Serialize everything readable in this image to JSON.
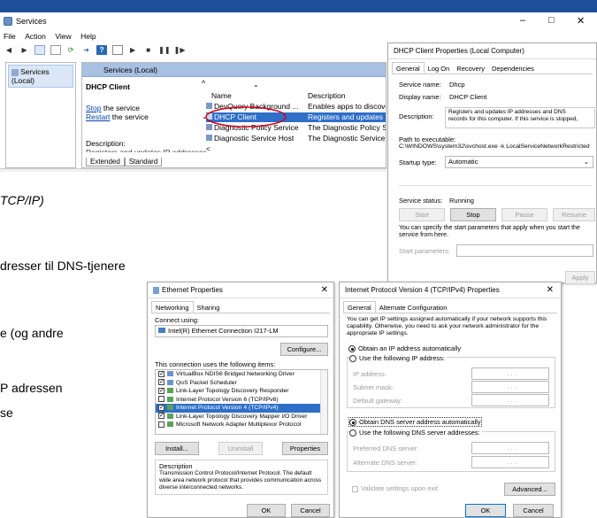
{
  "services": {
    "title": "Services",
    "menu": [
      "File",
      "Action",
      "View",
      "Help"
    ],
    "tree_item": "Services (Local)",
    "panel_header": "Services (Local)",
    "selected_service": "DHCP Client",
    "stop_link": "Stop",
    "stop_suffix": " the service",
    "restart_link": "Restart",
    "restart_suffix": " the service",
    "description_label": "Description:",
    "description_cut": "Registers and updates IP addresses",
    "col_name": "Name",
    "col_description": "Description",
    "rows": [
      {
        "name": "DevQuery Background ...",
        "desc": "Enables apps to discover"
      },
      {
        "name": "DHCP Client",
        "desc": "Registers and updates IP"
      },
      {
        "name": "Diagnostic Policy Service",
        "desc": "The Diagnostic Policy Se"
      },
      {
        "name": "Diagnostic Service Host",
        "desc": "The Diagnostic Service H"
      }
    ],
    "tab_extended": "Extended",
    "tab_standard": "Standard",
    "win_min": "–",
    "win_max": "□",
    "win_close": "✕"
  },
  "dhcp": {
    "title": "DHCP Client Properties (Local Computer)",
    "tabs": [
      "General",
      "Log On",
      "Recovery",
      "Dependencies"
    ],
    "service_name_label": "Service name:",
    "service_name": "Dhcp",
    "display_name_label": "Display name:",
    "display_name": "DHCP Client",
    "description_label": "Description:",
    "description": "Registers and updates IP addresses and DNS records for this computer. If this service is stopped,",
    "path_label": "Path to executable:",
    "path": "C:\\WINDOWS\\system32\\svchost.exe -k LocalServiceNetworkRestricted",
    "startup_label": "Startup type:",
    "startup_value": "Automatic",
    "status_label": "Service status:",
    "status_value": "Running",
    "btn_start": "Start",
    "btn_stop": "Stop",
    "btn_pause": "Pause",
    "btn_resume": "Resume",
    "hint": "You can specify the start parameters that apply when you start the service from here.",
    "start_params_label": "Start parameters:",
    "btn_apply": "Apply"
  },
  "doc_fragments": [
    "TCP/IP)",
    "dresser til DNS-tjenere",
    "e (og andre",
    "P adressen",
    "se"
  ],
  "ethernet": {
    "title": "Ethernet Properties",
    "tabs": [
      "Networking",
      "Sharing"
    ],
    "connect_using": "Connect using:",
    "adapter": "Intel(R) Ethernet Connection I217-LM",
    "configure": "Configure...",
    "items_label": "This connection uses the following items:",
    "items": [
      {
        "label": "VirtualBox NDIS6 Bridged Networking Driver",
        "checked": true
      },
      {
        "label": "QoS Packet Scheduler",
        "checked": true
      },
      {
        "label": "Link-Layer Topology Discovery Responder",
        "checked": true
      },
      {
        "label": "Internet Protocol Version 6 (TCP/IPv6)",
        "checked": false
      },
      {
        "label": "Internet Protocol Version 4 (TCP/IPv4)",
        "checked": true
      },
      {
        "label": "Link-Layer Topology Discovery Mapper I/O Driver",
        "checked": true
      },
      {
        "label": "Microsoft Network Adapter Multiplexor Protocol",
        "checked": false
      }
    ],
    "install": "Install...",
    "uninstall": "Uninstall",
    "properties": "Properties",
    "description_label": "Description",
    "description": "Transmission Control Protocol/Internet Protocol. The default wide area network protocol that provides communication across diverse interconnected networks.",
    "ok": "OK",
    "cancel": "Cancel"
  },
  "ipv4": {
    "title": "Internet Protocol Version 4 (TCP/IPv4) Properties",
    "tabs": [
      "General",
      "Alternate Configuration"
    ],
    "intro": "You can get IP settings assigned automatically if your network supports this capability. Otherwise, you need to ask your network administrator for the appropriate IP settings.",
    "obtain_ip": "Obtain an IP address automatically",
    "use_ip": "Use the following IP address:",
    "ip_address": "IP address:",
    "subnet": "Subnet mask:",
    "gateway": "Default gateway:",
    "obtain_dns": "Obtain DNS server address automatically",
    "use_dns": "Use the following DNS server addresses:",
    "preferred_dns": "Preferred DNS server:",
    "alternate_dns": "Alternate DNS server:",
    "validate": "Validate settings upon exit",
    "advanced": "Advanced...",
    "ok": "OK",
    "cancel": "Cancel",
    "dots": ".   .   ."
  },
  "colors": {
    "header": "#1f4e99",
    "selection": "#2f6fc8",
    "highlight_circle": "#d0021b"
  }
}
